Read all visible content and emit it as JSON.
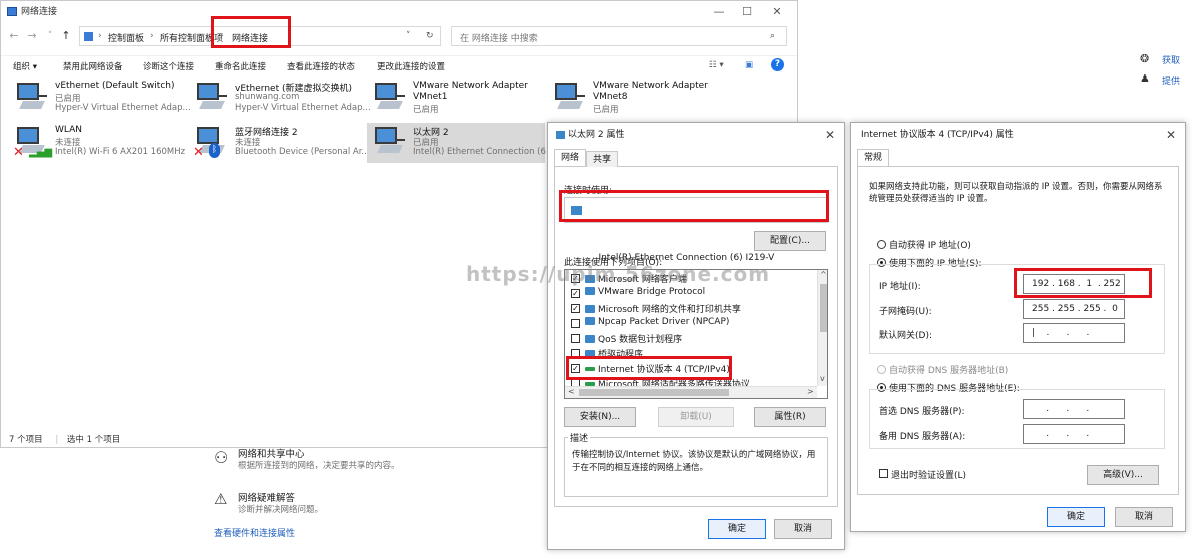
{
  "explorer": {
    "title": "网络连接",
    "address": {
      "crumbs": [
        "控制面板",
        "所有控制面板项",
        "网络连接"
      ],
      "search_placeholder": "在 网络连接 中搜索"
    },
    "toolbar": [
      "组织 ▾",
      "禁用此网络设备",
      "诊断这个连接",
      "重命名此连接",
      "查看此连接的状态",
      "更改此连接的设置"
    ],
    "adapters": [
      {
        "name": "vEthernet (Default Switch)",
        "status": "已启用",
        "device": "Hyper-V Virtual Ethernet Adap...",
        "disconnected": false,
        "selected": false
      },
      {
        "name": "vEthernet (新建虚拟交换机)",
        "status": "shunwang.com",
        "device": "Hyper-V Virtual Ethernet Adap...",
        "disconnected": false,
        "selected": false
      },
      {
        "name": "VMware Network Adapter VMnet1",
        "status": "已启用",
        "device": "",
        "disconnected": false,
        "selected": false
      },
      {
        "name": "VMware Network Adapter VMnet8",
        "status": "已启用",
        "device": "",
        "disconnected": false,
        "selected": false
      },
      {
        "name": "WLAN",
        "status": "未连接",
        "device": "Intel(R) Wi-Fi 6 AX201 160MHz",
        "disconnected": true,
        "selected": false
      },
      {
        "name": "蓝牙网络连接 2",
        "status": "未连接",
        "device": "Bluetooth Device (Personal Ar...",
        "disconnected": true,
        "selected": false
      },
      {
        "name": "以太网 2",
        "status": "已启用",
        "device": "Intel(R) Ethernet Connection (6...",
        "disconnected": false,
        "selected": true
      }
    ],
    "status_bar": {
      "count": "7 个项目",
      "selected": "选中 1 个项目"
    }
  },
  "control_panel": {
    "network_center": {
      "title": "网络和共享中心",
      "subtitle": "根据所连接到的网络，决定要共享的内容。"
    },
    "troubleshoot": {
      "title": "网络疑难解答",
      "subtitle": "诊断并解决网络问题。"
    },
    "hardware_link": "查看硬件和连接属性"
  },
  "right_edge": {
    "get_help": "获取",
    "feedback": "提供"
  },
  "props_dialog": {
    "title": "以太网 2 属性",
    "tabs": [
      "网络",
      "共享"
    ],
    "connect_using_label": "连接时使用:",
    "adapter": "Intel(R) Ethernet Connection (6) I219-V",
    "configure_button": "配置(C)...",
    "items_label": "此连接使用下列项目(O):",
    "items": [
      {
        "label": "Microsoft 网络客户端",
        "checked": true
      },
      {
        "label": "VMware Bridge Protocol",
        "checked": true
      },
      {
        "label": "Microsoft 网络的文件和打印机共享",
        "checked": true
      },
      {
        "label": "Npcap Packet Driver (NPCAP)",
        "checked": false
      },
      {
        "label": "QoS 数据包计划程序",
        "checked": false
      },
      {
        "label": "桥驱动程序",
        "checked": false
      },
      {
        "label": "Internet 协议版本 4 (TCP/IPv4)",
        "checked": true
      },
      {
        "label": "Microsoft 网络适配器多路传送器协议",
        "checked": false
      }
    ],
    "install_button": "安装(N)...",
    "uninstall_button": "卸载(U)",
    "properties_button": "属性(R)",
    "description_label": "描述",
    "description": "传输控制协议/Internet 协议。该协议是默认的广域网络协议，用于在不同的相互连接的网络上通信。",
    "ok_button": "确定",
    "cancel_button": "取消"
  },
  "ipv4_dialog": {
    "title": "Internet 协议版本 4 (TCP/IPv4) 属性",
    "tab": "常规",
    "intro": "如果网络支持此功能，则可以获取自动指派的 IP 设置。否则，你需要从网络系统管理员处获得适当的 IP 设置。",
    "auto_ip": "自动获得 IP 地址(O)",
    "manual_ip": "使用下面的 IP 地址(S):",
    "ip_label": "IP 地址(I):",
    "ip_value": "192 . 168 .  1  . 252",
    "mask_label": "子网掩码(U):",
    "mask_value": "255 . 255 . 255 .  0",
    "gateway_label": "默认网关(D):",
    "gateway_value": "|    .      .      .",
    "auto_dns": "自动获得 DNS 服务器地址(B)",
    "manual_dns": "使用下面的 DNS 服务器地址(E):",
    "preferred_dns_label": "首选 DNS 服务器(P):",
    "preferred_dns_value": "     .      .      .",
    "alternate_dns_label": "备用 DNS 服务器(A):",
    "alternate_dns_value": "     .      .      .",
    "validate_label": "退出时验证设置(L)",
    "advanced_button": "高级(V)...",
    "ok_button": "确定",
    "cancel_button": "取消"
  },
  "watermark": "https://upim.56zone.com",
  "colors": {
    "highlight_red": "#e0131a",
    "link_blue": "#1f5fbd",
    "accent": "#1a73e8"
  }
}
